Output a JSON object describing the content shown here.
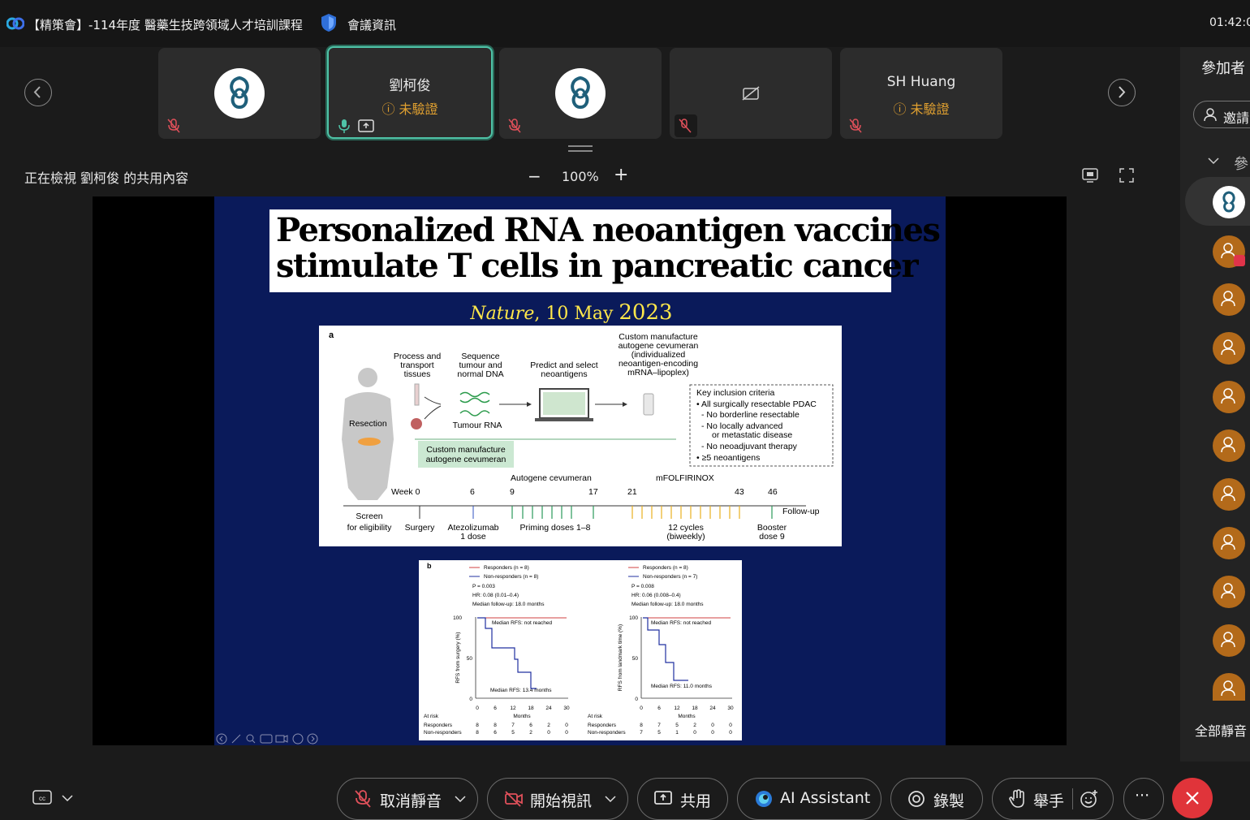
{
  "titlebar": {
    "app_title": "【精策會】-114年度 醫藥生技跨領域人才培訓課程",
    "meeting_info": "會議資訊",
    "clock": "01:42:0"
  },
  "participants": [
    {
      "name": "",
      "status": "",
      "type": "logo"
    },
    {
      "name": "劉柯俊",
      "status": "未驗證",
      "type": "name",
      "active": true
    },
    {
      "name": "",
      "status": "",
      "type": "logo"
    },
    {
      "name": "",
      "status": "",
      "type": "video-off"
    },
    {
      "name": "SH Huang",
      "status": "未驗證",
      "type": "name"
    }
  ],
  "share": {
    "viewing_label": "正在檢視 劉柯俊 的共用內容",
    "zoom_out": "−",
    "zoom_value": "100%",
    "zoom_in": "+"
  },
  "slide": {
    "title_line1": "Personalized RNA neoantigen vaccines",
    "title_line2": "stimulate T cells in pancreatic cancer",
    "journal": "Nature",
    "date": ", 10 May ",
    "year": "2023",
    "fig_a": {
      "panel": "a",
      "steps": [
        "Process and",
        "transport",
        "tissues",
        "Sequence",
        "tumour and",
        "normal DNA",
        "Predict and select",
        "neoantigens",
        "Custom manufacture",
        "autogene cevumeran",
        "(individualized",
        "neoantigen-encoding",
        "mRNA–lipoplex)"
      ],
      "resection": "Resection",
      "tumour_rna": "Tumour RNA",
      "custom_box_1": "Custom manufacture",
      "custom_box_2": "autogene cevumeran",
      "criteria_title": "Key inclusion criteria",
      "criteria": [
        "• All surgically resectable PDAC",
        "- No borderline resectable",
        "- No locally advanced",
        "or metastatic disease",
        "- No neoadjuvant therapy",
        "• ≥5 neoantigens"
      ],
      "autogene": "Autogene cevumeran",
      "mfolfirinox": "mFOLFIRINOX",
      "week_label": "Week 0",
      "weeks": [
        "6",
        "9",
        "17",
        "21",
        "43",
        "46"
      ],
      "follow_up": "Follow-up",
      "timeline_labels": [
        "Screen",
        "for eligibility",
        "Surgery",
        "Atezolizumab",
        "1 dose",
        "Priming doses 1–8",
        "12 cycles",
        "(biweekly)",
        "Booster",
        "dose 9"
      ]
    },
    "fig_b": {
      "panel": "b",
      "left": {
        "legend_r": "Responders (n = 8)",
        "legend_n": "Non-responders (n = 8)",
        "p": "P = 0.003",
        "hr": "HR: 0.08 (0.01–0.4)",
        "median_fu": "Median follow-up: 18.0 months",
        "median_rfs_r": "Median RFS: not reached",
        "median_rfs_n": "Median RFS: 13.4 months",
        "ylabel": "RFS from surgery (%)",
        "xlabel": "Months",
        "yticks": [
          "100",
          "50",
          "0"
        ],
        "xticks": [
          "0",
          "6",
          "12",
          "18",
          "24",
          "30"
        ],
        "at_risk": "At risk",
        "row_r": "Responders",
        "row_n": "Non-responders",
        "risk_r": [
          "8",
          "8",
          "7",
          "6",
          "2",
          "0"
        ],
        "risk_n": [
          "8",
          "6",
          "5",
          "2",
          "0",
          "0"
        ]
      },
      "right": {
        "legend_r": "Responders (n = 8)",
        "legend_n": "Non-responders (n = 7)",
        "p": "P = 0.008",
        "hr": "HR: 0.06 (0.008–0.4)",
        "median_fu": "Median follow-up: 18.0 months",
        "median_rfs_r": "Median RFS: not reached",
        "median_rfs_n": "Median RFS: 11.0 months",
        "ylabel": "RFS from landmark time (%)",
        "xlabel": "Months",
        "yticks": [
          "100",
          "50",
          "0"
        ],
        "xticks": [
          "0",
          "6",
          "12",
          "18",
          "24",
          "30"
        ],
        "at_risk": "At risk",
        "row_r": "Responders",
        "row_n": "Non-responders",
        "risk_r": [
          "8",
          "7",
          "5",
          "2",
          "0",
          "0"
        ],
        "risk_n": [
          "7",
          "5",
          "1",
          "0",
          "0",
          "0"
        ]
      }
    }
  },
  "right_panel": {
    "title": "參加者",
    "invite": "邀請",
    "section": "參",
    "mute_all": "全部靜音"
  },
  "toolbar": {
    "unmute": "取消靜音",
    "start_video": "開始視訊",
    "share": "共用",
    "ai_assistant": "AI Assistant",
    "record": "錄製",
    "raise_hand": "舉手",
    "more": "···"
  },
  "colors": {
    "accent_teal": "#4fc3a7",
    "warning": "#e0a030",
    "slide_bg": "#0a1a5a",
    "leave_red": "#e0343a",
    "avatar_orange": "#b36a1a"
  }
}
